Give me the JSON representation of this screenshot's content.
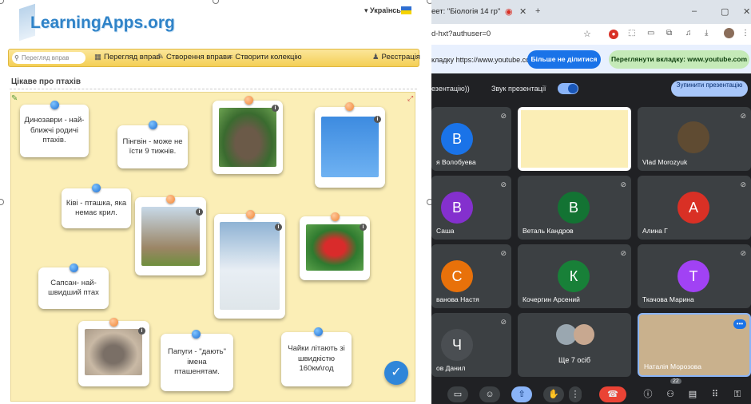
{
  "learningapps": {
    "logo": "LearningApps.org",
    "language": "Українська",
    "search_placeholder": "Перегляд вправ",
    "nav": [
      "Перегляд вправ",
      "Створення вправи",
      "Створити колекцію",
      "Реєстрація"
    ],
    "activity_title": "Цікаве про птахів",
    "cards": [
      "Динозаври - най-ближчі родичі птахів.",
      "Пінгвін - може не їсти 9 тижнів.",
      "Ківі - пташка, яка немає крил.",
      "Сапсан- най-швидший птах",
      "Папуги - \"дають\" імена пташенятам.",
      "Чайки літають зі швидкістю 160км\\год"
    ]
  },
  "browser": {
    "tab_title": "еет: \"Біологія 14 гр\"",
    "address": "d-hxt?authuser=0",
    "share_text": "кладку https://www.youtube.com",
    "stop_share": "Більше не ділитися",
    "view_tab": "Переглянути вкладку: www.youtube.com"
  },
  "meet": {
    "presentation_label": "езентацію))",
    "sound_label": "Звук презентації",
    "stop_presentation": "Зупинити презентацію",
    "participants": [
      {
        "name": "я Волобуева",
        "initial": "В",
        "color": "#1a73e8"
      },
      {
        "name": "Vlad Morozyuk",
        "initial": "",
        "color": "#5f4b32"
      },
      {
        "name": "Саша",
        "initial": "В",
        "color": "#8430ce"
      },
      {
        "name": "Веталь Кандров",
        "initial": "В",
        "color": "#137333"
      },
      {
        "name": "Алина Г",
        "initial": "А",
        "color": "#d93025"
      },
      {
        "name": "ванова Настя",
        "initial": "С",
        "color": "#e8710a"
      },
      {
        "name": "Кочергин Арсений",
        "initial": "К",
        "color": "#188038"
      },
      {
        "name": "Ткачова Марина",
        "initial": "Т",
        "color": "#a142f4"
      },
      {
        "name": "ов Данил",
        "initial": "Ч",
        "color": "#3c4043"
      },
      {
        "name": "Ще 7 осіб",
        "initial": "",
        "color": "#3c4043"
      },
      {
        "name": "Наталія Морозова",
        "initial": "",
        "color": "#c9b18d"
      }
    ],
    "people_count": "22"
  }
}
